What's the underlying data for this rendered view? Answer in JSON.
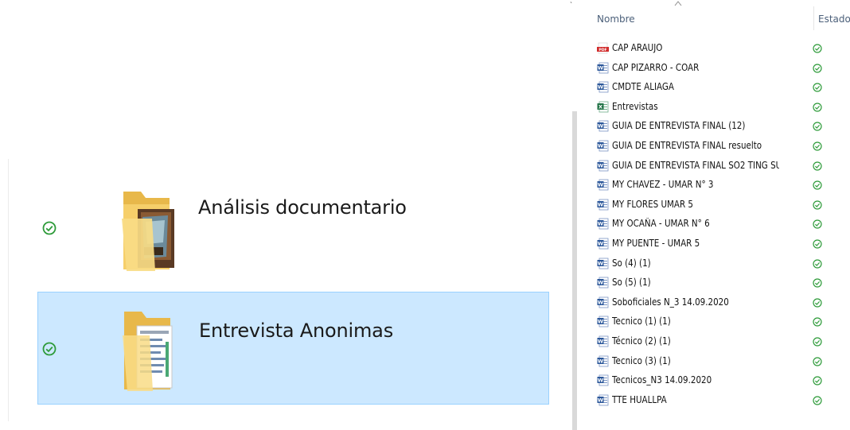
{
  "left_pane": {
    "folders": [
      {
        "name": "Análisis documentario",
        "status": "synced",
        "selected": false,
        "icon": "folder-with-book-icon"
      },
      {
        "name": "Entrevista Anonimas",
        "status": "synced",
        "selected": true,
        "icon": "folder-with-documents-icon"
      }
    ]
  },
  "details_pane": {
    "columns": {
      "name": "Nombre",
      "status": "Estado"
    },
    "files": [
      {
        "name": "CAP ARAUJO",
        "type": "pdf"
      },
      {
        "name": "CAP PIZARRO - COAR",
        "type": "word"
      },
      {
        "name": "CMDTE ALIAGA",
        "type": "word"
      },
      {
        "name": "Entrevistas",
        "type": "excel"
      },
      {
        "name": "GUIA DE ENTREVISTA FINAL (12)",
        "type": "word"
      },
      {
        "name": "GUIA DE ENTREVISTA FINAL resuelto",
        "type": "word"
      },
      {
        "name": "GUIA DE ENTREVISTA FINAL SO2 TING SU...",
        "type": "word"
      },
      {
        "name": "MY CHAVEZ - UMAR N° 3",
        "type": "word"
      },
      {
        "name": "MY FLORES UMAR 5",
        "type": "word"
      },
      {
        "name": "MY OCAÑA - UMAR N° 6",
        "type": "word"
      },
      {
        "name": "MY PUENTE - UMAR 5",
        "type": "word"
      },
      {
        "name": "So (4) (1)",
        "type": "word"
      },
      {
        "name": "So (5) (1)",
        "type": "word"
      },
      {
        "name": "Soboficiales N_3 14.09.2020",
        "type": "word"
      },
      {
        "name": "Tecnico (1) (1)",
        "type": "word"
      },
      {
        "name": "Técnico (2) (1)",
        "type": "word"
      },
      {
        "name": "Tecnico (3) (1)",
        "type": "word"
      },
      {
        "name": "Tecnicos_N3 14.09.2020",
        "type": "word"
      },
      {
        "name": "TTE HUALLPA",
        "type": "word"
      }
    ]
  },
  "colors": {
    "selection_bg": "#cce8ff",
    "selection_border": "#99d1ff",
    "synced_green": "#2e9b3a",
    "header_text": "#4c607a",
    "word_blue": "#2b579a",
    "excel_green": "#217346",
    "pdf_red": "#d12b2b"
  }
}
